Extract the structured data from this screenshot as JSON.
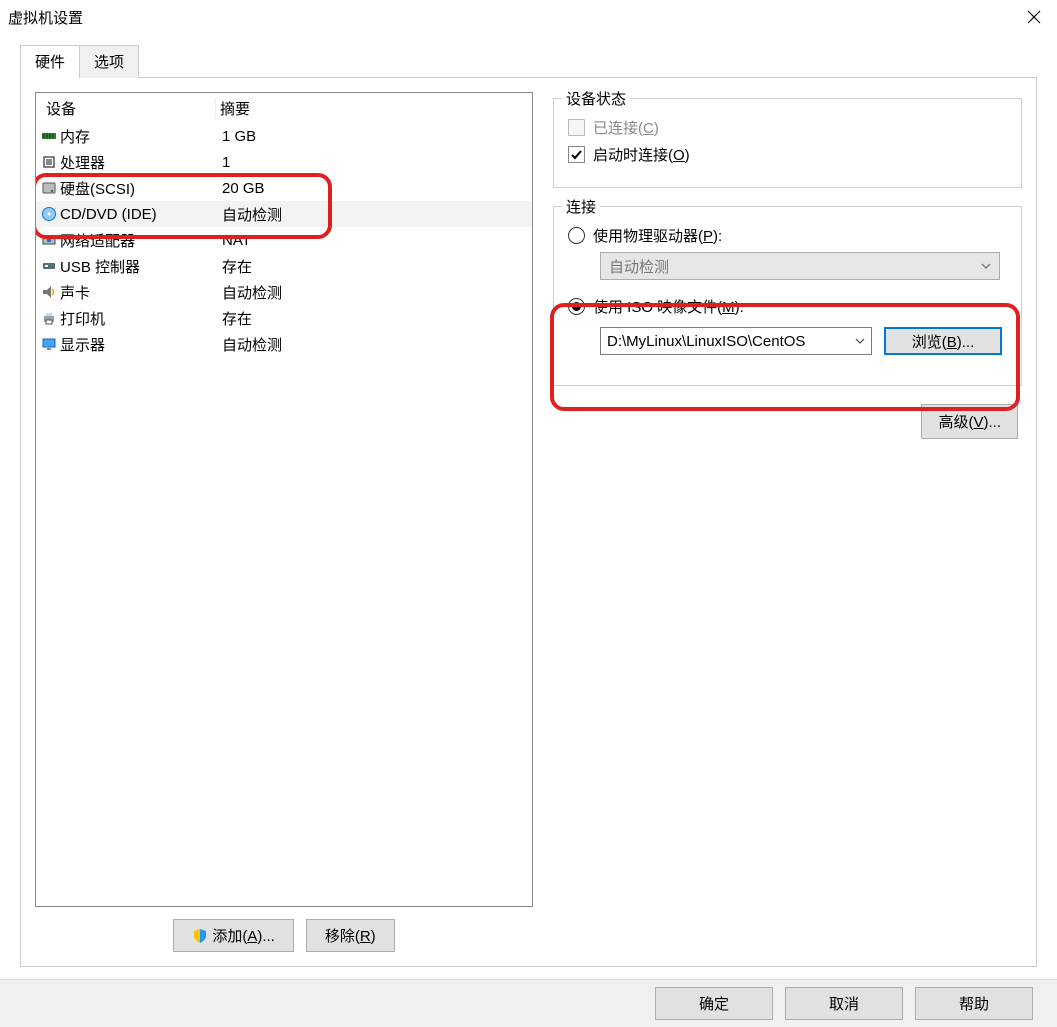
{
  "window": {
    "title": "虚拟机设置"
  },
  "tabs": {
    "hardware": "硬件",
    "options": "选项"
  },
  "headers": {
    "device": "设备",
    "summary": "摘要"
  },
  "devices": [
    {
      "name": "内存",
      "summary": "1 GB",
      "icon": "memory"
    },
    {
      "name": "处理器",
      "summary": "1",
      "icon": "cpu"
    },
    {
      "name": "硬盘(SCSI)",
      "summary": "20 GB",
      "icon": "hdd"
    },
    {
      "name": "CD/DVD (IDE)",
      "summary": "自动检测",
      "icon": "cd"
    },
    {
      "name": "网络适配器",
      "summary": "NAT",
      "icon": "net"
    },
    {
      "name": "USB 控制器",
      "summary": "存在",
      "icon": "usb"
    },
    {
      "name": "声卡",
      "summary": "自动检测",
      "icon": "sound"
    },
    {
      "name": "打印机",
      "summary": "存在",
      "icon": "printer"
    },
    {
      "name": "显示器",
      "summary": "自动检测",
      "icon": "display"
    }
  ],
  "buttons": {
    "add": "添加(",
    "add_key": "A",
    "add_suffix": ")...",
    "remove": "移除(",
    "remove_key": "R",
    "remove_suffix": ")",
    "ok": "确定",
    "cancel": "取消",
    "help": "帮助",
    "advanced": "高级(",
    "advanced_key": "V",
    "advanced_suffix": ")...",
    "browse": "浏览(",
    "browse_key": "B",
    "browse_suffix": ")..."
  },
  "right": {
    "device_state_legend": "设备状态",
    "connected": "已连接(",
    "connected_key": "C",
    "connected_suffix": ")",
    "connect_power": "启动时连接(",
    "connect_power_key": "O",
    "connect_power_suffix": ")",
    "connection_legend": "连接",
    "use_physical": "使用物理驱动器(",
    "use_physical_key": "P",
    "use_physical_suffix": "):",
    "auto_detect": "自动检测",
    "use_iso": "使用 ISO 映像文件(",
    "use_iso_key": "M",
    "use_iso_suffix": "):",
    "iso_path": "D:\\MyLinux\\LinuxISO\\CentOS"
  }
}
